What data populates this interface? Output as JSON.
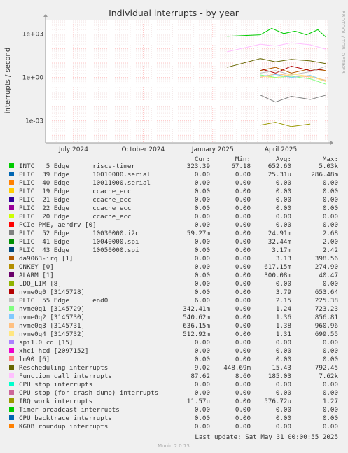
{
  "chart_data": {
    "type": "line",
    "title": "Individual interrupts - by year",
    "ylabel": "interrupts / second",
    "y_scale": "log",
    "ylim": [
      3e-05,
      10000
    ],
    "y_ticks": [
      {
        "value": 1000,
        "label": "1e+03"
      },
      {
        "value": 1,
        "label": "1e+00"
      },
      {
        "value": 0.001,
        "label": "1e-03"
      }
    ],
    "x_range": [
      "2024-05-25",
      "2025-06-02"
    ],
    "x_ticks": [
      {
        "date": "2024-07-01",
        "label": "July 2024"
      },
      {
        "date": "2024-10-01",
        "label": "October 2024"
      },
      {
        "date": "2025-01-01",
        "label": "January 2025"
      },
      {
        "date": "2025-04-01",
        "label": "April 2025"
      }
    ],
    "grid": true,
    "side_label": "RRDTOOL / TOBI OETIKER",
    "legend_headers": {
      "cur": "Cur:",
      "min": "Min:",
      "avg": "Avg:",
      "max": "Max:"
    },
    "series": [
      {
        "label": "INTC   5 Edge      riscv-timer",
        "color": "#00cc00",
        "cur": "323.39",
        "min": "67.18",
        "avg": "652.60",
        "max": "5.03k",
        "points": [
          [
            "2025-01-20",
            700
          ],
          [
            "2025-03-05",
            900
          ],
          [
            "2025-03-20",
            2500
          ],
          [
            "2025-04-05",
            1100
          ],
          [
            "2025-04-20",
            1600
          ],
          [
            "2025-05-05",
            900
          ],
          [
            "2025-05-20",
            2000
          ],
          [
            "2025-05-31",
            600
          ]
        ]
      },
      {
        "label": "PLIC  39 Edge      10010000.serial",
        "color": "#0066b3",
        "cur": "0.00",
        "min": "0.00",
        "avg": "25.31u",
        "max": "286.48m",
        "points": []
      },
      {
        "label": "PLIC  40 Edge      10011000.serial",
        "color": "#ff8000",
        "cur": "0.00",
        "min": "0.00",
        "avg": "0.00",
        "max": "0.00",
        "points": []
      },
      {
        "label": "PLIC  19 Edge      ccache_ecc",
        "color": "#ffcc00",
        "cur": "0.00",
        "min": "0.00",
        "avg": "0.00",
        "max": "0.00",
        "points": []
      },
      {
        "label": "PLIC  21 Edge      ccache_ecc",
        "color": "#330099",
        "cur": "0.00",
        "min": "0.00",
        "avg": "0.00",
        "max": "0.00",
        "points": []
      },
      {
        "label": "PLIC  22 Edge      ccache_ecc",
        "color": "#990099",
        "cur": "0.00",
        "min": "0.00",
        "avg": "0.00",
        "max": "0.00",
        "points": []
      },
      {
        "label": "PLIC  20 Edge      ccache_ecc",
        "color": "#ccff00",
        "cur": "0.00",
        "min": "0.00",
        "avg": "0.00",
        "max": "0.00",
        "points": []
      },
      {
        "label": "PCIe PME, aerdrv [0]",
        "color": "#ff0000",
        "cur": "0.00",
        "min": "0.00",
        "avg": "0.00",
        "max": "0.00",
        "points": []
      },
      {
        "label": "PLIC  52 Edge      10030000.i2c",
        "color": "#808080",
        "cur": "59.27m",
        "min": "0.00",
        "avg": "24.91m",
        "max": "2.68",
        "points": [
          [
            "2025-03-05",
            0.06
          ],
          [
            "2025-03-25",
            0.02
          ],
          [
            "2025-04-15",
            0.05
          ],
          [
            "2025-05-10",
            0.03
          ],
          [
            "2025-05-31",
            0.06
          ]
        ]
      },
      {
        "label": "PLIC  41 Edge      10040000.spi",
        "color": "#008f00",
        "cur": "0.00",
        "min": "0.00",
        "avg": "32.44m",
        "max": "2.00",
        "points": []
      },
      {
        "label": "PLIC  43 Edge      10050000.spi",
        "color": "#00487d",
        "cur": "0.00",
        "min": "0.00",
        "avg": "3.17m",
        "max": "2.42",
        "points": []
      },
      {
        "label": "da9063-irq [1]",
        "color": "#b35a00",
        "cur": "0.00",
        "min": "0.00",
        "avg": "3.13",
        "max": "398.56",
        "points": [
          [
            "2025-03-05",
            3
          ],
          [
            "2025-03-25",
            5
          ],
          [
            "2025-04-15",
            2
          ],
          [
            "2025-05-10",
            4
          ],
          [
            "2025-05-31",
            3
          ]
        ]
      },
      {
        "label": "ONKEY [0]",
        "color": "#b38f00",
        "cur": "0.00",
        "min": "0.00",
        "avg": "617.15m",
        "max": "274.90",
        "points": []
      },
      {
        "label": "ALARM [1]",
        "color": "#6b006b",
        "cur": "0.00",
        "min": "0.00",
        "avg": "300.08m",
        "max": "40.47",
        "points": []
      },
      {
        "label": "LDO_LIM [8]",
        "color": "#8fb300",
        "cur": "0.00",
        "min": "0.00",
        "avg": "0.00",
        "max": "0.00",
        "points": []
      },
      {
        "label": "nvme0q0 [3145728]",
        "color": "#b30000",
        "cur": "0.00",
        "min": "0.00",
        "avg": "3.79",
        "max": "653.64",
        "points": [
          [
            "2025-03-05",
            4
          ],
          [
            "2025-03-25",
            2
          ],
          [
            "2025-04-15",
            6
          ],
          [
            "2025-05-10",
            3
          ],
          [
            "2025-05-31",
            4
          ]
        ]
      },
      {
        "label": "PLIC  55 Edge      end0",
        "color": "#bebebe",
        "cur": "6.00",
        "min": "0.00",
        "avg": "2.15",
        "max": "225.38",
        "points": [
          [
            "2025-03-05",
            2
          ],
          [
            "2025-03-25",
            3
          ],
          [
            "2025-04-15",
            1.5
          ],
          [
            "2025-05-10",
            2.5
          ],
          [
            "2025-05-31",
            6
          ]
        ]
      },
      {
        "label": "nvme0q1 [3145729]",
        "color": "#80ff80",
        "cur": "342.41m",
        "min": "0.00",
        "avg": "1.24",
        "max": "723.23",
        "points": [
          [
            "2025-03-05",
            1.5
          ],
          [
            "2025-03-25",
            1
          ],
          [
            "2025-04-15",
            1.2
          ],
          [
            "2025-05-10",
            0.8
          ],
          [
            "2025-05-31",
            0.34
          ]
        ]
      },
      {
        "label": "nvme0q2 [3145730]",
        "color": "#80c9ff",
        "cur": "540.62m",
        "min": "0.00",
        "avg": "1.36",
        "max": "856.81",
        "points": [
          [
            "2025-03-05",
            1.2
          ],
          [
            "2025-03-25",
            1.6
          ],
          [
            "2025-04-15",
            1
          ],
          [
            "2025-05-10",
            1.4
          ],
          [
            "2025-05-31",
            0.54
          ]
        ]
      },
      {
        "label": "nvme0q3 [3145731]",
        "color": "#ffc080",
        "cur": "636.15m",
        "min": "0.00",
        "avg": "1.38",
        "max": "960.96",
        "points": [
          [
            "2025-03-05",
            1
          ],
          [
            "2025-03-25",
            1.8
          ],
          [
            "2025-04-15",
            1.3
          ],
          [
            "2025-05-10",
            1.1
          ],
          [
            "2025-05-31",
            0.64
          ]
        ]
      },
      {
        "label": "nvme0q4 [3145732]",
        "color": "#ffe680",
        "cur": "512.92m",
        "min": "0.00",
        "avg": "1.31",
        "max": "699.55",
        "points": [
          [
            "2025-03-05",
            1.3
          ],
          [
            "2025-03-25",
            0.9
          ],
          [
            "2025-04-15",
            1.7
          ],
          [
            "2025-05-10",
            1.2
          ],
          [
            "2025-05-31",
            0.51
          ]
        ]
      },
      {
        "label": "spi1.0 cd [15]",
        "color": "#aa80ff",
        "cur": "0.00",
        "min": "0.00",
        "avg": "0.00",
        "max": "0.00",
        "points": []
      },
      {
        "label": "xhci_hcd [2097152]",
        "color": "#ee00cc",
        "cur": "0.00",
        "min": "0.00",
        "avg": "0.00",
        "max": "0.00",
        "points": []
      },
      {
        "label": "lm90 [6]",
        "color": "#ff8080",
        "cur": "0.00",
        "min": "0.00",
        "avg": "0.00",
        "max": "0.00",
        "points": []
      },
      {
        "label": "Rescheduling interrupts",
        "color": "#666600",
        "cur": "9.02",
        "min": "448.69m",
        "avg": "15.43",
        "max": "792.45",
        "points": [
          [
            "2025-01-20",
            5
          ],
          [
            "2025-03-05",
            20
          ],
          [
            "2025-03-25",
            12
          ],
          [
            "2025-04-15",
            18
          ],
          [
            "2025-05-10",
            14
          ],
          [
            "2025-05-31",
            9
          ]
        ]
      },
      {
        "label": "Function call interrupts",
        "color": "#ffbfff",
        "cur": "87.62",
        "min": "8.60",
        "avg": "185.03",
        "max": "7.62k",
        "points": [
          [
            "2025-01-20",
            60
          ],
          [
            "2025-03-05",
            200
          ],
          [
            "2025-03-25",
            150
          ],
          [
            "2025-04-15",
            250
          ],
          [
            "2025-05-10",
            180
          ],
          [
            "2025-05-31",
            88
          ]
        ]
      },
      {
        "label": "CPU stop interrupts",
        "color": "#00ffcc",
        "cur": "0.00",
        "min": "0.00",
        "avg": "0.00",
        "max": "0.00",
        "points": []
      },
      {
        "label": "CPU stop (for crash dump) interrupts",
        "color": "#cc6699",
        "cur": "0.00",
        "min": "0.00",
        "avg": "0.00",
        "max": "0.00",
        "points": []
      },
      {
        "label": "IRQ work interrupts",
        "color": "#999900",
        "cur": "11.57u",
        "min": "0.00",
        "avg": "576.72u",
        "max": "1.27",
        "points": [
          [
            "2025-03-05",
            0.0005
          ],
          [
            "2025-03-25",
            0.0008
          ],
          [
            "2025-04-15",
            0.0004
          ],
          [
            "2025-05-10",
            0.0006
          ]
        ]
      },
      {
        "label": "Timer broadcast interrupts",
        "color": "#00cc00",
        "cur": "0.00",
        "min": "0.00",
        "avg": "0.00",
        "max": "0.00",
        "points": []
      },
      {
        "label": "CPU backtrace interrupts",
        "color": "#0066b3",
        "cur": "0.00",
        "min": "0.00",
        "avg": "0.00",
        "max": "0.00",
        "points": []
      },
      {
        "label": "KGDB roundup interrupts",
        "color": "#ff8000",
        "cur": "0.00",
        "min": "0.00",
        "avg": "0.00",
        "max": "0.00",
        "points": []
      }
    ],
    "last_update": "Last update: Sat May 31 00:00:55 2025",
    "footer": "Munin 2.0.73"
  }
}
